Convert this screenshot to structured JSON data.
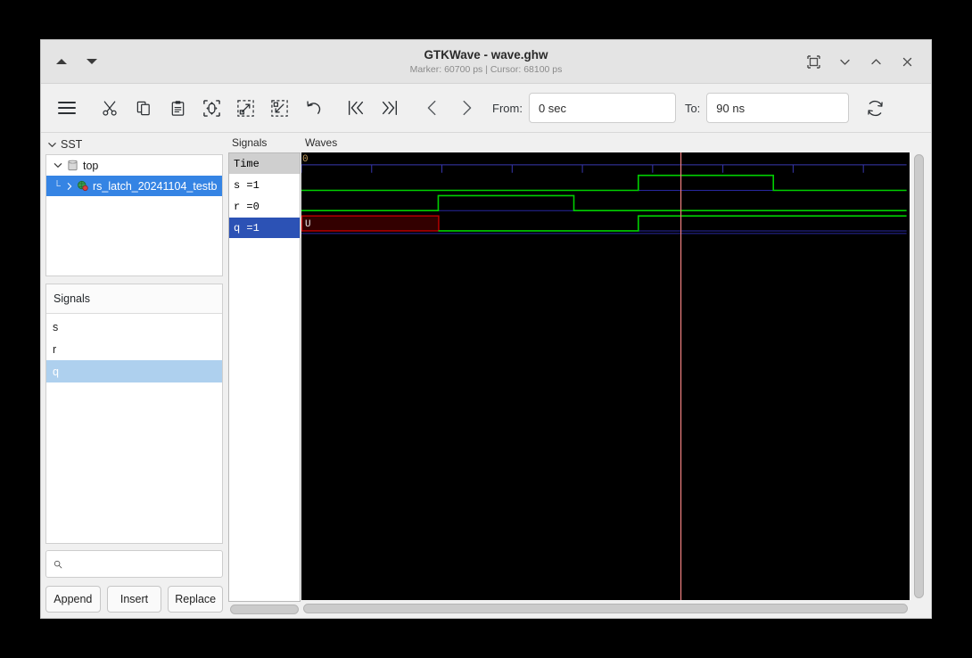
{
  "window": {
    "title": "GTKWave - wave.ghw",
    "subtitle": "Marker: 60700 ps  |  Cursor: 68100 ps",
    "nav_up": "▲",
    "nav_down": "▼",
    "controls": [
      {
        "name": "fullscreen-button",
        "label": "fullscreen-icon"
      },
      {
        "name": "minimize-button",
        "label": "chevron-down-icon"
      },
      {
        "name": "maximize-button",
        "label": "chevron-up-icon"
      },
      {
        "name": "close-button",
        "label": "close-icon"
      }
    ]
  },
  "toolbar": {
    "menu": "menu-icon",
    "cut": "cut-icon",
    "copy": "copy-icon",
    "paste": "paste-icon",
    "zoom_fit": "zoom-fit-icon",
    "zoom_in": "zoom-in-icon",
    "zoom_out": "zoom-out-icon",
    "undo": "undo-icon",
    "first": "go-to-start-icon",
    "last": "go-to-end-icon",
    "prev": "previous-icon",
    "next": "next-icon",
    "from_label": "From:",
    "from_value": "0 sec",
    "to_label": "To:",
    "to_value": "90 ns",
    "reload": "reload-icon"
  },
  "sidebar": {
    "sst_label": "SST",
    "tree": [
      {
        "label": "top",
        "level": 0,
        "expanded": true,
        "selected": false
      },
      {
        "label": "rs_latch_20241104_testb",
        "level": 1,
        "expanded": false,
        "selected": true
      }
    ],
    "signals_panel_title": "Signals",
    "signals": [
      {
        "label": "s",
        "selected": false
      },
      {
        "label": "r",
        "selected": false
      },
      {
        "label": "q",
        "selected": true
      }
    ],
    "search_placeholder": "",
    "search_value": "",
    "search_icon": "search-icon",
    "buttons": [
      {
        "name": "append-button",
        "label": "Append"
      },
      {
        "name": "insert-button",
        "label": "Insert"
      },
      {
        "name": "replace-button",
        "label": "Replace"
      }
    ]
  },
  "signal_values": {
    "header": "Signals",
    "rows": [
      {
        "label": "Time",
        "kind": "time",
        "selected": false
      },
      {
        "label": "s =1",
        "kind": "signal",
        "selected": false
      },
      {
        "label": "r =0",
        "kind": "signal",
        "selected": false
      },
      {
        "label": "q =1",
        "kind": "signal",
        "selected": true
      }
    ]
  },
  "waves": {
    "header": "Waves",
    "time_origin_label": "0",
    "colors": {
      "background": "#000000",
      "signal_high": "#00d000",
      "baseline": "#2828a0",
      "undefined_fill": "#330000",
      "undefined_border": "#c00000",
      "cursor": "#f08080",
      "tick": "#3838b0"
    },
    "cursor_x_pct": 62.4,
    "ruler": {
      "tick_count": 9,
      "tick_spacing_pct": 11.55
    },
    "signals": [
      {
        "name": "s",
        "row": 0,
        "transitions": [
          {
            "x_pct": 0.0,
            "value": "0"
          },
          {
            "x_pct": 55.4,
            "value": "1"
          },
          {
            "x_pct": 77.6,
            "value": "0"
          }
        ]
      },
      {
        "name": "r",
        "row": 1,
        "transitions": [
          {
            "x_pct": 0.0,
            "value": "0"
          },
          {
            "x_pct": 22.5,
            "value": "1"
          },
          {
            "x_pct": 44.8,
            "value": "0"
          }
        ]
      },
      {
        "name": "q",
        "row": 2,
        "undefined_region": {
          "start_pct": 0.0,
          "end_pct": 22.5,
          "label": "U"
        },
        "transitions": [
          {
            "x_pct": 22.5,
            "value": "0"
          },
          {
            "x_pct": 55.4,
            "value": "1"
          }
        ]
      }
    ],
    "end_x_pct": 99.5
  },
  "scrollbars": {
    "signals_hscroll": "signals-hscrollbar",
    "waves_hscroll": "waves-hscrollbar",
    "waves_vscroll": "waves-vscrollbar"
  }
}
